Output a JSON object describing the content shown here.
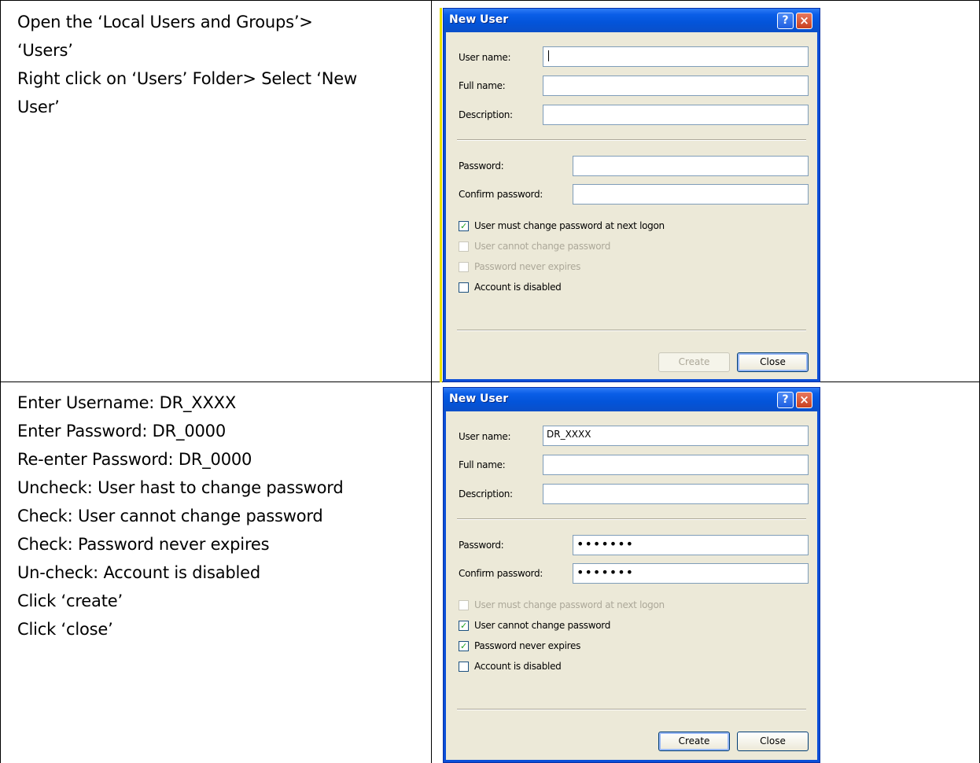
{
  "rows": [
    {
      "instructions": [
        "Open the ‘Local Users and Groups’>",
        "‘Users’",
        "Right click on ‘Users’ Folder> Select ‘New",
        "User’"
      ],
      "dialog": {
        "title": "New User",
        "help_glyph": "?",
        "close_glyph": "×",
        "labels": {
          "user_name": "User name:",
          "full_name": "Full name:",
          "description": "Description:",
          "password": "Password:",
          "confirm_password": "Confirm password:"
        },
        "values": {
          "user_name": "",
          "full_name": "",
          "description": "",
          "password": "",
          "confirm_password": ""
        },
        "checkboxes": [
          {
            "label": "User must change password at next logon",
            "checked": true,
            "enabled": true
          },
          {
            "label": "User cannot change password",
            "checked": false,
            "enabled": false
          },
          {
            "label": "Password never expires",
            "checked": false,
            "enabled": false
          },
          {
            "label": "Account is disabled",
            "checked": false,
            "enabled": true
          }
        ],
        "buttons": {
          "create": "Create",
          "close": "Close"
        },
        "create_enabled": false
      }
    },
    {
      "instructions": [
        "Enter Username: DR_XXXX",
        "Enter Password: DR_0000",
        "Re-enter Password: DR_0000",
        "Uncheck: User hast to change password",
        "Check: User cannot change password",
        "Check: Password never expires",
        "Un-check: Account is disabled",
        "Click ‘create’",
        "Click ‘close’"
      ],
      "dialog": {
        "title": "New User",
        "help_glyph": "?",
        "close_glyph": "×",
        "labels": {
          "user_name": "User name:",
          "full_name": "Full name:",
          "description": "Description:",
          "password": "Password:",
          "confirm_password": "Confirm password:"
        },
        "values": {
          "user_name": "DR_XXXX",
          "full_name": "",
          "description": "",
          "password": "•••••••",
          "confirm_password": "•••••••"
        },
        "checkboxes": [
          {
            "label": "User must change password at next logon",
            "checked": false,
            "enabled": false
          },
          {
            "label": "User cannot change password",
            "checked": true,
            "enabled": true
          },
          {
            "label": "Password never expires",
            "checked": true,
            "enabled": true
          },
          {
            "label": "Account is disabled",
            "checked": false,
            "enabled": true
          }
        ],
        "buttons": {
          "create": "Create",
          "close": "Close"
        },
        "create_enabled": true
      }
    }
  ],
  "checkmark_glyph": "✓"
}
